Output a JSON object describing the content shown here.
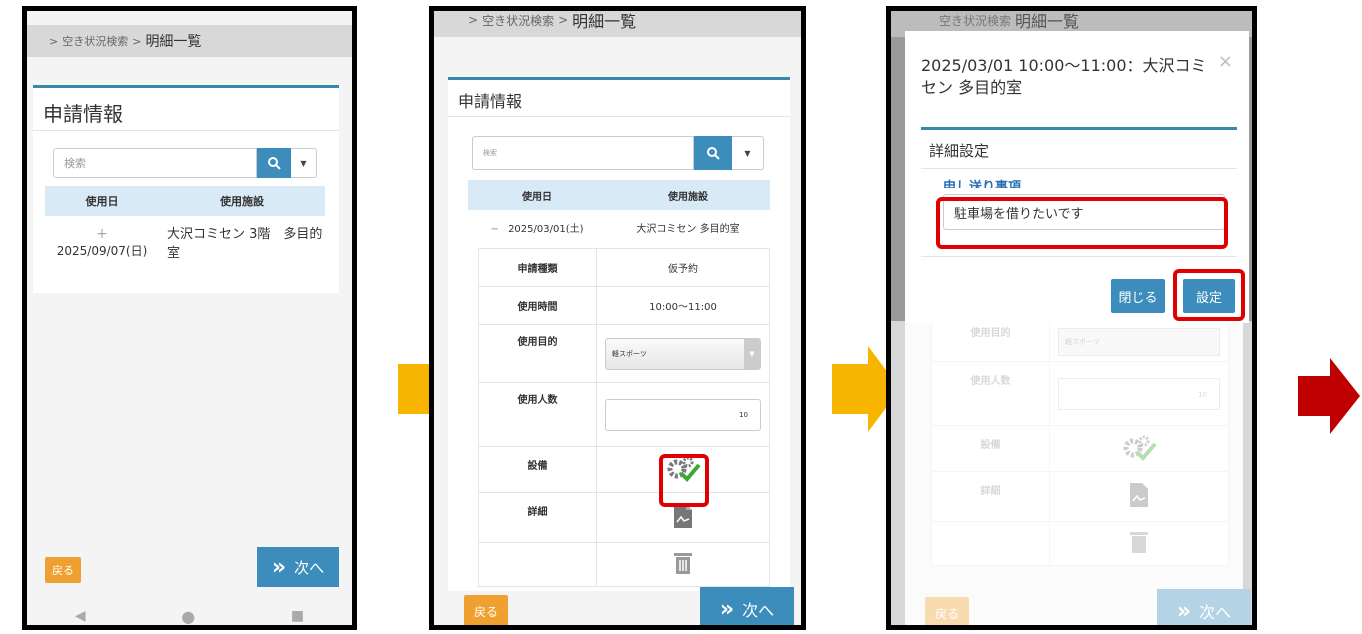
{
  "breadcrumb": {
    "sep": ">",
    "parent": "空き状況検索",
    "current": "明細一覧"
  },
  "section_title": "申請情報",
  "search": {
    "placeholder": "検索"
  },
  "table": {
    "col_date": "使用日",
    "col_facility": "使用施設"
  },
  "screen1": {
    "row": {
      "date": "2025/09/07(日)",
      "facility": "大沢コミセン 3階　多目的室",
      "expand": "+"
    }
  },
  "screen2": {
    "row": {
      "date": "2025/03/01(土)",
      "facility": "大沢コミセン 多目的室",
      "collapse": "−"
    },
    "details": [
      {
        "label": "申請種類",
        "value": "仮予約"
      },
      {
        "label": "使用時間",
        "value": "10:00〜11:00"
      },
      {
        "label": "使用目的",
        "value": "軽スポーツ"
      },
      {
        "label": "使用人数",
        "value": "10"
      },
      {
        "label": "設備",
        "value": ""
      },
      {
        "label": "詳細",
        "value": ""
      }
    ]
  },
  "modal": {
    "title": "2025/03/01 10:00〜11:00：大沢コミセン 多目的室",
    "close": "×",
    "section": "詳細設定",
    "field_label": "申し送り事項",
    "field_value": "駐車場を借りたいです",
    "close_button": "閉じる",
    "set_button": "設定"
  },
  "footer": {
    "back": "戻る",
    "next": "次へ",
    "next_icon": "»"
  },
  "icons": [
    "chevron-right-icon",
    "search-icon",
    "gear-check-icon",
    "document-icon",
    "trash-icon",
    "arrow-right-icon"
  ],
  "colors": {
    "accent": "#3c8dbc",
    "back": "#f0a030",
    "highlight": "#e00000",
    "flow_arrow": "#f7b500",
    "final_arrow": "#c00000"
  }
}
